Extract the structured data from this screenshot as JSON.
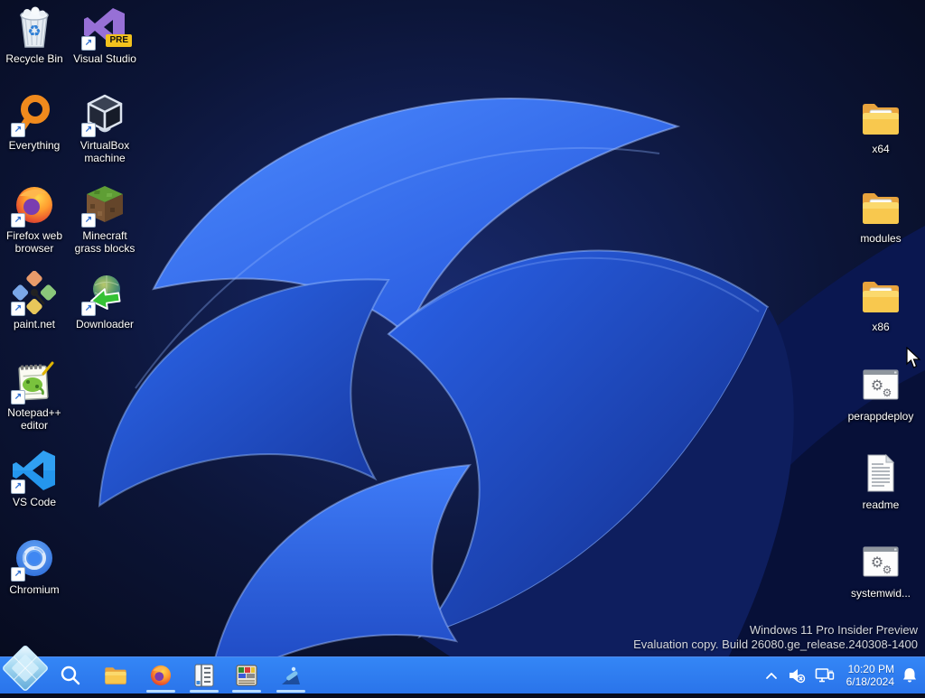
{
  "colors": {
    "taskbar": "#2e7bf0",
    "accent_light": "#bfe0ff",
    "label_text": "#ffffff",
    "watermark_text": "#d4d7dc",
    "folder_yellow": "#f5b73c",
    "wallpaper_bright_blue": "#2f6df2",
    "wallpaper_dark_navy": "#0a1750"
  },
  "desktop": {
    "left_icons": [
      {
        "icon": "recycle-bin-icon",
        "label": "Recycle Bin",
        "shortcut": false,
        "badge": ""
      },
      {
        "icon": "visual-studio-icon",
        "label": "Visual Studio",
        "shortcut": true,
        "badge": "PRE"
      },
      {
        "icon": "everything-search-icon",
        "label": "Everything",
        "shortcut": true,
        "badge": ""
      },
      {
        "icon": "virtualbox-icon",
        "label": "VirtualBox machine",
        "shortcut": true,
        "badge": ""
      },
      {
        "icon": "firefox-icon",
        "label": "Firefox web browser",
        "shortcut": true,
        "badge": ""
      },
      {
        "icon": "minecraft-icon",
        "label": "Minecraft grass blocks",
        "shortcut": true,
        "badge": ""
      },
      {
        "icon": "paint-dot-net-icon",
        "label": "paint.net",
        "shortcut": true,
        "badge": ""
      },
      {
        "icon": "idm-icon",
        "label": "Downloader",
        "shortcut": true,
        "badge": ""
      },
      {
        "icon": "notepad-plus-plus-icon",
        "label": "Notepad++ editor",
        "shortcut": true,
        "badge": ""
      },
      {
        "icon": "vscode-icon",
        "label": "VS Code",
        "shortcut": true,
        "badge": ""
      },
      {
        "icon": "chromium-icon",
        "label": "Chromium",
        "shortcut": true,
        "badge": ""
      }
    ],
    "right_icons": [
      {
        "icon": "folder-icon",
        "label": "x64"
      },
      {
        "icon": "folder-icon",
        "label": "modules"
      },
      {
        "icon": "folder-icon",
        "label": "x86"
      },
      {
        "icon": "gear-window-icon",
        "label": "perappdeploy"
      },
      {
        "icon": "text-document-icon",
        "label": "readme"
      },
      {
        "icon": "gear-window-icon",
        "label": "systemwid..."
      }
    ],
    "watermark": {
      "line1": "Windows 11 Pro Insider Preview",
      "line2": "Evaluation copy. Build 26080.ge_release.240308-1400"
    }
  },
  "taskbar": {
    "buttons": [
      {
        "icon": "start-crystal-icon"
      },
      {
        "icon": "search-icon"
      },
      {
        "icon": "file-explorer-icon"
      },
      {
        "icon": "firefox-icon",
        "running": true
      },
      {
        "icon": "ledger-book-icon",
        "running": true
      },
      {
        "icon": "legacy-pixel-app-icon",
        "running": true
      },
      {
        "icon": "magic-wand-app-icon",
        "running": true
      }
    ],
    "tray": {
      "icons": [
        "chevron-up-icon",
        "volume-muted-icon",
        "network-ethernet-icon",
        "notification-bell-icon"
      ],
      "time": "10:20 PM",
      "date": "6/18/2024"
    }
  }
}
